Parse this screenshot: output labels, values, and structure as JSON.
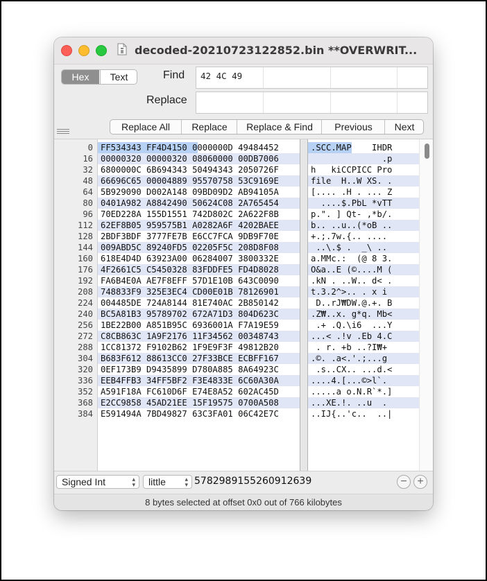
{
  "window": {
    "title": "decoded-20210723122852.bin **OVERWRIT...",
    "colors": {
      "close": "#ff5f57",
      "minimize": "#febc2e",
      "zoom": "#28c840"
    }
  },
  "mode_toggle": {
    "hex_label": "Hex",
    "text_label": "Text",
    "selected": "Hex"
  },
  "find": {
    "label": "Find",
    "value": "42 4C 49"
  },
  "replace": {
    "label": "Replace",
    "value": ""
  },
  "buttons": {
    "replace_all": "Replace All",
    "replace": "Replace",
    "replace_find": "Replace & Find",
    "previous": "Previous",
    "next": "Next"
  },
  "rows": [
    {
      "offset": "0",
      "hex": "FF534343 FF4D4150 0000000D 49484452",
      "text": ".SCC.MAP    IHDR"
    },
    {
      "offset": "16",
      "hex": "00000320 00000320 08060000 00DB7006",
      "text": "              .p"
    },
    {
      "offset": "32",
      "hex": "6800000C 6B694343 50494343 2050726F",
      "text": "h   kiCCPICC Pro"
    },
    {
      "offset": "48",
      "hex": "66696C65 00004889 95570758 53C9169E",
      "text": "file  H..W XS. ."
    },
    {
      "offset": "64",
      "hex": "5B929090 D002A148 09BD09D2 AB94105A",
      "text": "[.... .H . ... Z"
    },
    {
      "offset": "80",
      "hex": "0401A982 A8842490 50624C08 2A765454",
      "text": "  ....$.PbL *vTT"
    },
    {
      "offset": "96",
      "hex": "70ED228A 155D1551 742D802C 2A622F8B",
      "text": "p.\". ] Qt- ,*b/."
    },
    {
      "offset": "112",
      "hex": "62EF8B05 959575B1 A0282A6F 4202BAEE",
      "text": "b.. ..u..(*oB .."
    },
    {
      "offset": "128",
      "hex": "2BDF3BDF 3777FE7B E6CC7FCA 9DB9F70E",
      "text": "+.;.7w.{.. ...."
    },
    {
      "offset": "144",
      "hex": "009ABD5C 89240FD5 02205F5C 208D8F08",
      "text": " ..\\.$ .  _\\ .."
    },
    {
      "offset": "160",
      "hex": "618E4D4D 63923A00 06284007 3800332E",
      "text": "a.MMc.:  (@ 8 3."
    },
    {
      "offset": "176",
      "hex": "4F2661C5 C5450328 83FDDFE5 FD4D8028",
      "text": "O&a..E (©....M ("
    },
    {
      "offset": "192",
      "hex": "FA6B4E0A AE7F8EFF 57D1E10B 643C0090",
      "text": ".kN . ..W.. d< ."
    },
    {
      "offset": "208",
      "hex": "748833F9 325E3EC4 CD00E01B 78126901",
      "text": "t.3.2^>.. . x i"
    },
    {
      "offset": "224",
      "hex": "004485DE 724A8144 81E740AC 2B850142",
      "text": " D..rJ₩DW.@.+. B"
    },
    {
      "offset": "240",
      "hex": "BC5A81B3 95789702 672A71D3 804D623C",
      "text": ".Z₩..x. g*q. Mb<"
    },
    {
      "offset": "256",
      "hex": "1BE22B00 A851B95C 6936001A F7A19E59",
      "text": " .+ .Q.\\i6  ...Y"
    },
    {
      "offset": "272",
      "hex": "C8CB863C 1A9F2176 11F34562 00348743",
      "text": "...< .!v .Eb 4.C"
    },
    {
      "offset": "288",
      "hex": "1CC81372 F9102B62 1F9E9F3F 49812B20",
      "text": " . r. +b ..?I₩+ "
    },
    {
      "offset": "304",
      "hex": "B683F612 88613CC0 27F33BCE ECBFF167",
      "text": ".©. .a<.'.;...g"
    },
    {
      "offset": "320",
      "hex": "0EF173B9 D9435899 D780A885 8A64923C",
      "text": " .s..CX.. ...d.<"
    },
    {
      "offset": "336",
      "hex": "EEB4FFB3 34FF5BF2 F3E4833E 6C60A30A",
      "text": "....4.[...©>l`."
    },
    {
      "offset": "352",
      "hex": "A591F18A FC610D6F E74E8A52 602AC45D",
      "text": ".....a o.N.R`*.]"
    },
    {
      "offset": "368",
      "hex": "E2CC9858 45AD21EE 15F19575 0700A508",
      "text": "...XE.!. ..u  . "
    },
    {
      "offset": "384",
      "hex": "E591494A 7BD49827 63C3FA01 06C42E7C",
      "text": "..IJ{..'c..  ..|"
    }
  ],
  "selection": {
    "offset": 0,
    "length": 8
  },
  "interpretation": {
    "type": "Signed Int",
    "endian": "little",
    "value": "5782989155260912639"
  },
  "status": "8 bytes selected at offset 0x0 out of 766 kilobytes"
}
